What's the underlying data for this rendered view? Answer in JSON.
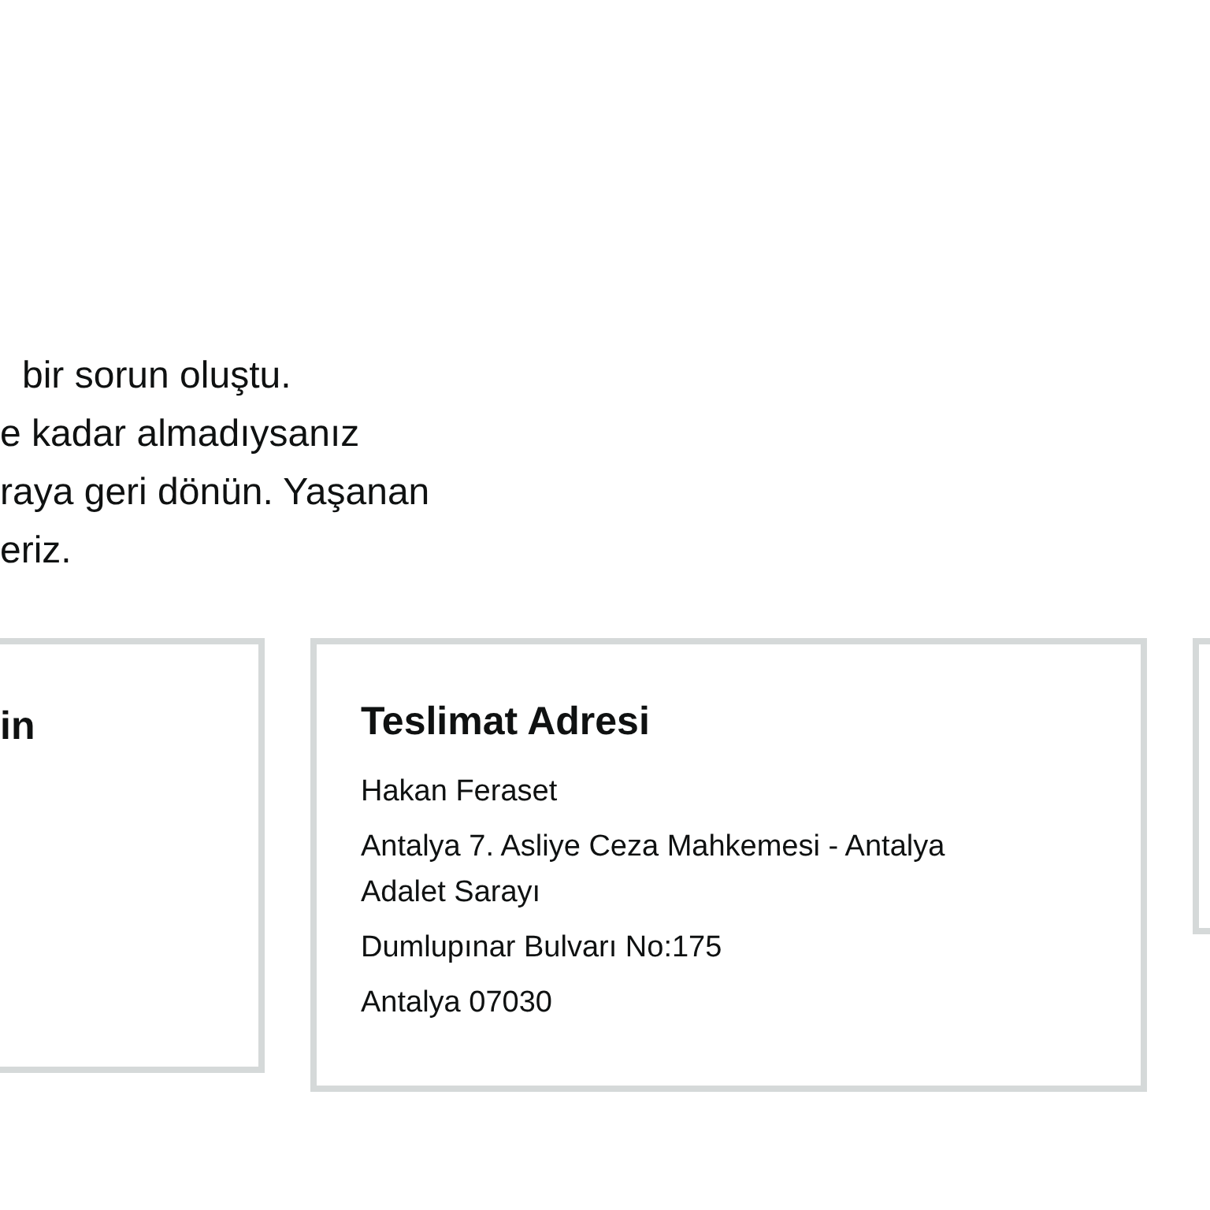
{
  "message_lines": [
    "bir sorun oluştu.",
    "e kadar almadıysanız",
    "raya geri dönün. Yaşanan",
    "eriz."
  ],
  "cards": [
    {
      "title": "in"
    },
    {
      "title": "Teslimat Adresi",
      "lines": [
        "Hakan Feraset",
        "Antalya 7. Asliye Ceza Mahkemesi - Antalya Adalet Sarayı",
        "Dumlupınar Bulvarı No:175",
        "Antalya 07030"
      ]
    }
  ]
}
